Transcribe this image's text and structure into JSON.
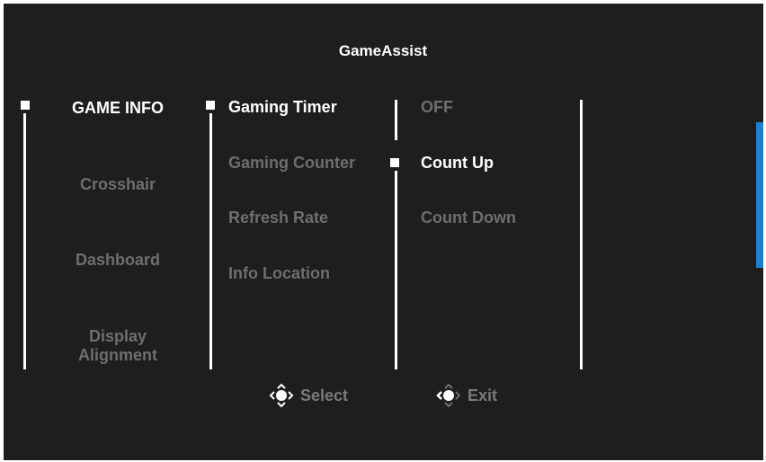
{
  "header": {
    "title": "GameAssist"
  },
  "menu": {
    "categories": [
      {
        "label": "GAME INFO",
        "selected": true
      },
      {
        "label": "Crosshair",
        "selected": false
      },
      {
        "label": "Dashboard",
        "selected": false
      },
      {
        "label": "Display Alignment",
        "selected": false
      }
    ],
    "options": [
      {
        "label": "Gaming Timer",
        "selected": true
      },
      {
        "label": "Gaming Counter",
        "selected": false
      },
      {
        "label": "Refresh Rate",
        "selected": false
      },
      {
        "label": "Info Location",
        "selected": false
      }
    ],
    "values": [
      {
        "label": "OFF",
        "selected": false
      },
      {
        "label": "Count Up",
        "selected": true
      },
      {
        "label": "Count Down",
        "selected": false
      }
    ]
  },
  "footer": {
    "select_label": "Select",
    "select_icon": "joystick-select-icon",
    "exit_label": "Exit",
    "exit_icon": "joystick-left-icon"
  },
  "colors": {
    "background": "#1e1e1e",
    "active_text": "#ffffff",
    "inactive_text": "#6e6e6e",
    "accent": "#1f7fd0"
  }
}
